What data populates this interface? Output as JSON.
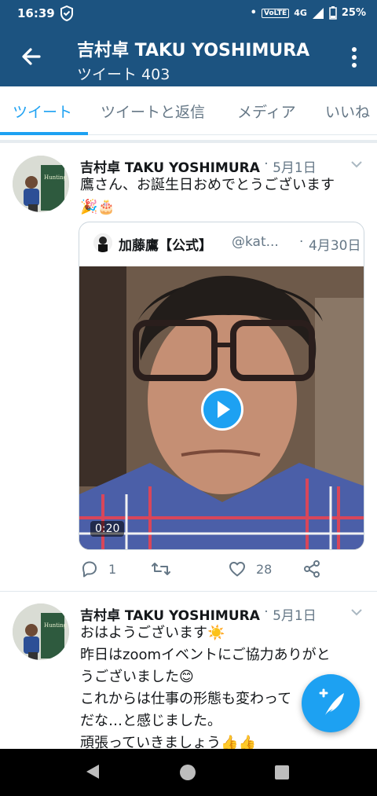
{
  "status_bar": {
    "time": "16:39",
    "network": "4G",
    "battery": "25%"
  },
  "header": {
    "title": "吉村卓 TAKU YOSHIMURA",
    "subtitle": "ツイート 403"
  },
  "tabs": [
    {
      "label": "ツイート",
      "active": true
    },
    {
      "label": "ツイートと返信",
      "active": false
    },
    {
      "label": "メディア",
      "active": false
    },
    {
      "label": "いいね",
      "active": false
    }
  ],
  "tweets": [
    {
      "name": "吉村卓 TAKU YOSHIMURA",
      "date": "5月1日",
      "text_line1": "鷹さん、お誕生日おめでとうございます",
      "text_line2": "🎉🎂",
      "quote": {
        "name": "加藤鷹【公式】",
        "handle": "@kat...",
        "date": "4月30日",
        "video_duration": "0:20"
      },
      "actions": {
        "replies": "1",
        "retweets": "",
        "likes": "28"
      }
    },
    {
      "name": "吉村卓 TAKU YOSHIMURA",
      "date": "5月1日",
      "lines": [
        "おはようございます☀️",
        "昨日はzoomイベントにご協力ありがと",
        "うございました😊",
        "これからは仕事の形態も変わって",
        "だな…と感じました。",
        "頑張っていきましょう👍👍"
      ]
    }
  ],
  "colors": {
    "header_bg": "#1c5380",
    "accent": "#1da1f2"
  }
}
